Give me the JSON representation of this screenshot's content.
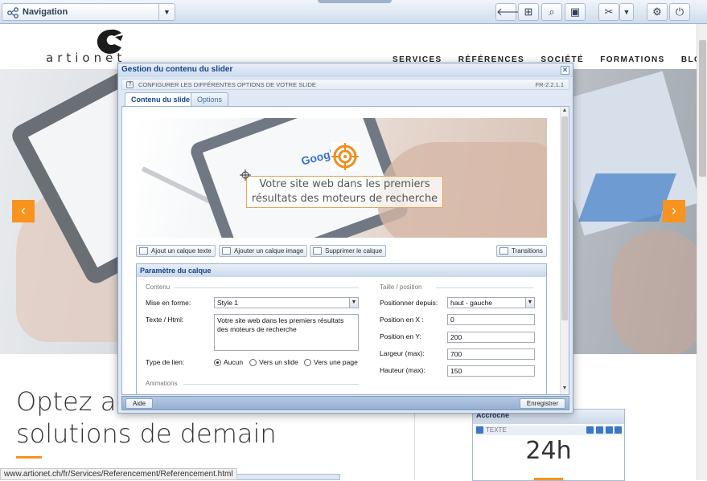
{
  "admin_bar": {
    "nav_label": "Navigation",
    "tools": [
      "back-icon",
      "add-page-icon",
      "preview-icon",
      "save-icon",
      "tools-icon",
      "dropdown-icon",
      "settings-icon",
      "power-icon"
    ]
  },
  "site": {
    "logo_text": "artionet",
    "nav": [
      "SERVICES",
      "RÉFÉRENCES",
      "SOCIÉTÉ",
      "FORMATIONS",
      "BLOG"
    ],
    "headline_1": "Optez au",
    "headline_2": "solutions de demain",
    "accroche_title": "Accroche",
    "accroche_sub": "TEXTE",
    "accroche_value": "24h",
    "status_url": "www.artionet.ch/fr/Services/Referencement/Referencement.html",
    "arrow_left": "‹",
    "arrow_right": "›",
    "accent": "#f7931e"
  },
  "dialog": {
    "title": "Gestion du contenu du slider",
    "subtitle": "CONFIGURER LES DIFFÉRENTES OPTIONS DE VOTRE SLIDE",
    "version": "FR-2.2.1.1",
    "tabs": [
      "Contenu du slide",
      "Options"
    ],
    "active_tab": "Contenu du slide",
    "slide_caption_1": "Votre site web dans les premiers",
    "slide_caption_2": "résultats des moteurs de recherche",
    "slide_logo_text": "Google",
    "buttons": {
      "add_text": "Ajout un calque texte",
      "add_image": "Ajouter un calque image",
      "delete": "Supprimer le calque",
      "transitions": "Transitions"
    },
    "param_title": "Paramètre du calque",
    "content_legend": "Contenu",
    "size_legend": "Taille / position",
    "anim_legend": "Animations",
    "fields": {
      "format_label": "Mise en forme:",
      "format_value": "Style 1",
      "text_label": "Texte / Html:",
      "text_value": "Votre site web dans les premiers résultats des moteurs de recherche",
      "link_label": "Type de lien:",
      "link_options": [
        "Aucun",
        "Vers un slide",
        "Vers une page"
      ],
      "link_selected": "Aucun",
      "position_from_label": "Positionner depuis:",
      "position_from_value": "haut - gauche",
      "pos_x_label": "Position en X :",
      "pos_x_value": "0",
      "pos_y_label": "Position en Y:",
      "pos_y_value": "200",
      "width_label": "Largeur (max):",
      "width_value": "700",
      "height_label": "Hauteur (max):",
      "height_value": "150"
    },
    "footer": {
      "help": "Aide",
      "save": "Enregistrer"
    }
  }
}
